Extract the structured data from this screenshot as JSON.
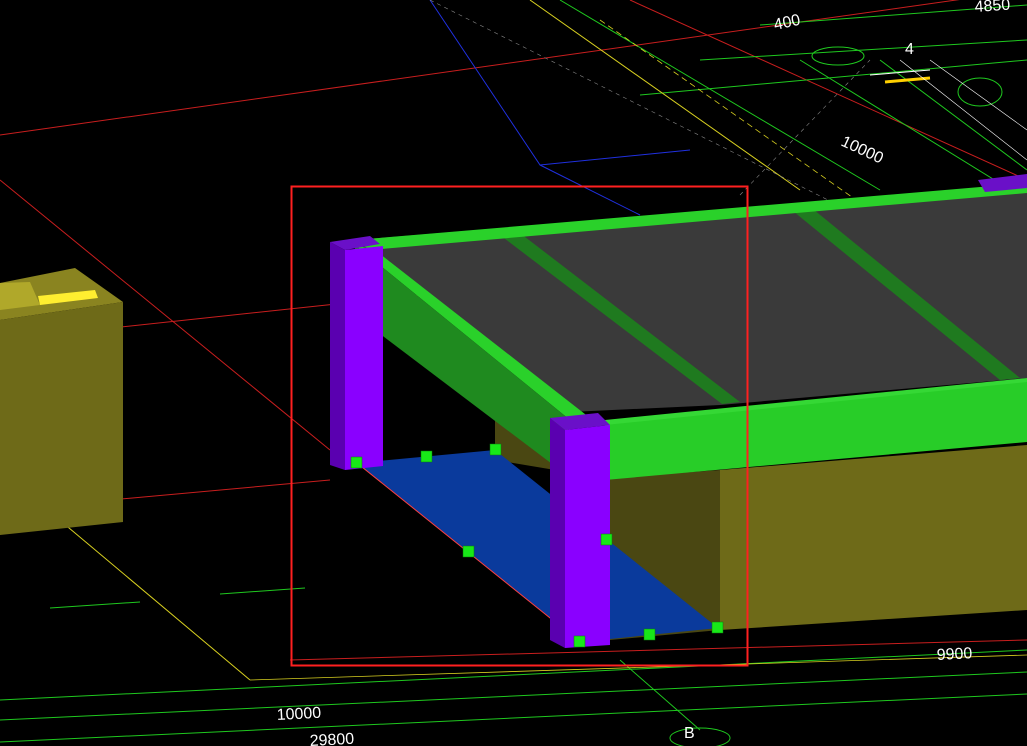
{
  "viewport": {
    "background_color": "#000000",
    "selection_box_color": "#ff2020",
    "grip_color": "#18e818"
  },
  "colors": {
    "column": "#8a00ff",
    "column_side": "#5a00b0",
    "beam": "#2ad12a",
    "beam_dark": "#1f8a1f",
    "slab": "#3c3c3c",
    "wall": "#6e6a18",
    "wall_dark": "#4a4712",
    "floor_selected": "#0a3a9c",
    "axis_red": "#d02020",
    "axis_green": "#20d020",
    "axis_yellow": "#d8d020",
    "axis_blue": "#2030e0"
  },
  "dimensions": {
    "top_400": "400",
    "top_4850": "4850",
    "diag_10000_upper": "10000",
    "right_9900": "9900",
    "bottom_10000": "10000",
    "bottom_29800": "29800"
  },
  "axis_labels": {
    "axis_4": "4",
    "axis_b": "B"
  }
}
